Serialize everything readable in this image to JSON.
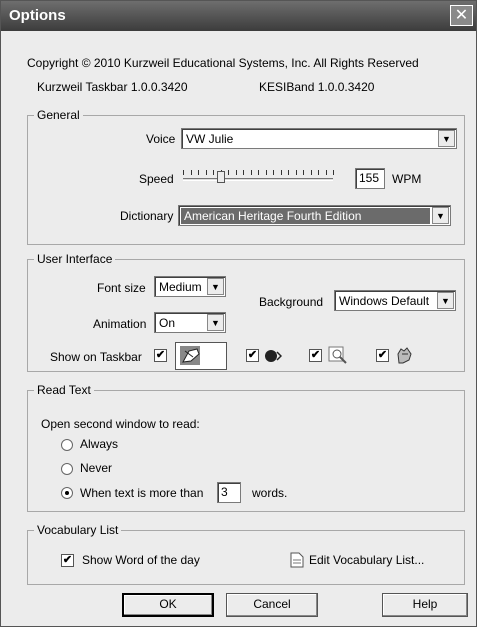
{
  "window": {
    "title": "Options",
    "close_glyph": "✕"
  },
  "header": {
    "copyright": "Copyright © 2010 Kurzweil Educational Systems, Inc. All Rights Reserved",
    "taskbar_version": "Kurzweil Taskbar 1.0.0.3420",
    "kesiband_version": "KESIBand 1.0.0.3420"
  },
  "general": {
    "legend": "General",
    "voice_label": "Voice",
    "voice_value": "VW Julie",
    "speed_label": "Speed",
    "speed_value": "155",
    "speed_unit": "WPM",
    "speed_level": 0.25,
    "dictionary_label": "Dictionary",
    "dictionary_value": "American Heritage Fourth Edition"
  },
  "ui": {
    "legend": "User Interface",
    "font_size_label": "Font size",
    "font_size_value": "Medium",
    "animation_label": "Animation",
    "animation_value": "On",
    "background_label": "Background",
    "background_value": "Windows Default",
    "show_taskbar_label": "Show on Taskbar",
    "taskbar_icons": [
      "read-hand-icon",
      "speaker-icon",
      "magnifier-icon",
      "hand-icon"
    ]
  },
  "read_text": {
    "legend": "Read Text",
    "prompt": "Open second window to read:",
    "opt_always": "Always",
    "opt_never": "Never",
    "opt_when": "When text is more than",
    "words_value": "3",
    "words_label": "words."
  },
  "vocab": {
    "legend": "Vocabulary List",
    "show_word": "Show Word of the day",
    "edit_link": "Edit Vocabulary List..."
  },
  "buttons": {
    "ok": "OK",
    "cancel": "Cancel",
    "help": "Help"
  },
  "glyphs": {
    "check": "✔",
    "arrow": "▼"
  }
}
